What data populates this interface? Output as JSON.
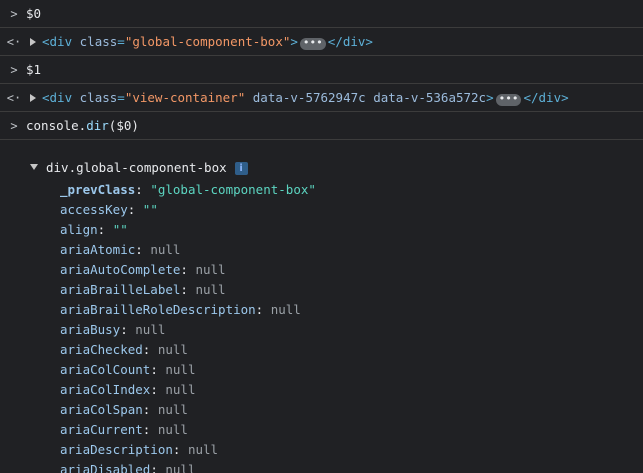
{
  "console": {
    "rows": [
      {
        "prompt": ">",
        "text": "$0"
      },
      {
        "prompt": "<·",
        "element": {
          "tag": "div",
          "attr": "class",
          "value": "\"global-component-box\"",
          "close": "</div>"
        }
      },
      {
        "prompt": ">",
        "text": "$1"
      },
      {
        "prompt": "<·",
        "element": {
          "tag": "div",
          "attr": "class",
          "value": "\"view-container\"",
          "extra1": "data-v-5762947c",
          "extra2": "data-v-536a572c",
          "close": "</div>"
        }
      },
      {
        "prompt": ">",
        "text_prefix": "console.",
        "text_fn": "dir",
        "text_suffix": "($0)"
      }
    ]
  },
  "object": {
    "header": "div.global-component-box",
    "info_badge": "i",
    "properties": [
      {
        "key": "_prevClass",
        "value": "\"global-component-box\"",
        "kind": "string"
      },
      {
        "key": "accessKey",
        "value": "\"\"",
        "kind": "string"
      },
      {
        "key": "align",
        "value": "\"\"",
        "kind": "string"
      },
      {
        "key": "ariaAtomic",
        "value": "null",
        "kind": "null"
      },
      {
        "key": "ariaAutoComplete",
        "value": "null",
        "kind": "null"
      },
      {
        "key": "ariaBrailleLabel",
        "value": "null",
        "kind": "null"
      },
      {
        "key": "ariaBrailleRoleDescription",
        "value": "null",
        "kind": "null"
      },
      {
        "key": "ariaBusy",
        "value": "null",
        "kind": "null"
      },
      {
        "key": "ariaChecked",
        "value": "null",
        "kind": "null"
      },
      {
        "key": "ariaColCount",
        "value": "null",
        "kind": "null"
      },
      {
        "key": "ariaColIndex",
        "value": "null",
        "kind": "null"
      },
      {
        "key": "ariaColSpan",
        "value": "null",
        "kind": "null"
      },
      {
        "key": "ariaCurrent",
        "value": "null",
        "kind": "null"
      },
      {
        "key": "ariaDescription",
        "value": "null",
        "kind": "null"
      },
      {
        "key": "ariaDisabled",
        "value": "null",
        "kind": "null"
      }
    ]
  },
  "colors": {
    "background": "#202124",
    "tag": "#5db0d7",
    "attr_name": "#9bbbdc",
    "attr_value": "#f29766",
    "prop_key": "#9cc8ec",
    "string": "#5cd5c1",
    "null": "#9aa0a6"
  }
}
